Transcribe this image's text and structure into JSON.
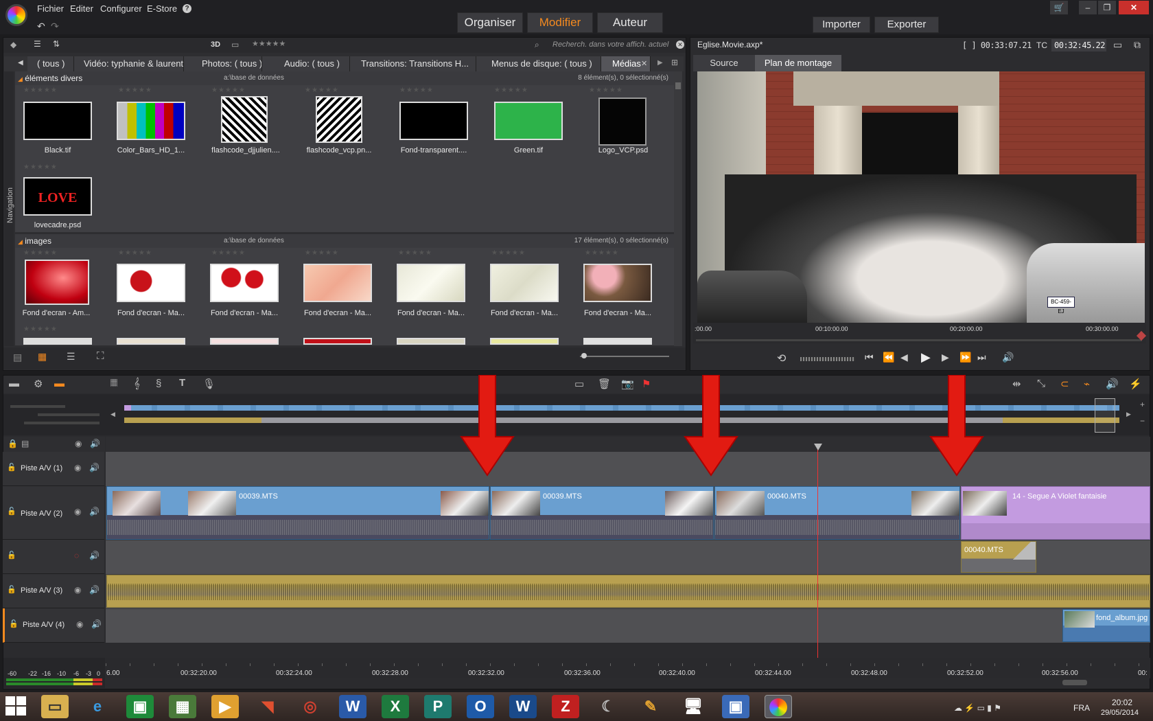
{
  "menu": {
    "fichier": "Fichier",
    "editer": "Editer",
    "configurer": "Configurer",
    "estore": "E-Store",
    "help": "?"
  },
  "modes": {
    "organiser": "Organiser",
    "modifier": "Modifier",
    "auteur": "Auteur"
  },
  "io": {
    "importer": "Importer",
    "exporter": "Exporter"
  },
  "library": {
    "toolbar": {
      "label_3d": "3D",
      "search_placeholder": "Recherch. dans votre affich. actuel"
    },
    "tabs": [
      "( tous )",
      "Vidéo: typhanie & laurent",
      "Photos: ( tous )",
      "Audio: ( tous )",
      "Transitions: Transitions H...",
      "Menus de disque: ( tous )",
      "Médias"
    ],
    "nav_label": "Navigation",
    "sections": [
      {
        "title": "éléments divers",
        "db": "a:\\base de données",
        "count": "8 élément(s), 0 sélectionné(s)",
        "items": [
          "Black.tif",
          "Color_Bars_HD_1...",
          "flashcode_djjulien....",
          "flashcode_vcp.pn...",
          "Fond-transparent....",
          "Green.tif",
          "Logo_VCP.psd",
          "lovecadre.psd"
        ]
      },
      {
        "title": "images",
        "db": "a:\\base de données",
        "count": "17 élément(s), 0 sélectionné(s)",
        "items": [
          "Fond d'ecran - Am...",
          "Fond d'ecran - Ma...",
          "Fond d'ecran - Ma...",
          "Fond d'ecran - Ma...",
          "Fond d'ecran - Ma...",
          "Fond d'ecran - Ma...",
          "Fond d'ecran - Ma..."
        ]
      }
    ],
    "lovecadre_text": "LOVE"
  },
  "preview": {
    "filename": "Eglise.Movie.axp*",
    "duration": "[ ] 00:33:07.21",
    "tc_label": "TC",
    "tc_value": "00:32:45.22",
    "tabs": [
      "Source",
      "Plan de montage"
    ],
    "ruler": [
      ":00.00",
      "00:10:00.00",
      "00:20:00.00",
      "00:30:00.00"
    ],
    "plate": "BC-459-EJ"
  },
  "timeline": {
    "tracks": [
      {
        "name": "Piste A/V (1)"
      },
      {
        "name": "Piste A/V (2)"
      },
      {
        "name": ""
      },
      {
        "name": "Piste A/V (3)"
      },
      {
        "name": "Piste A/V (4)"
      }
    ],
    "clips": {
      "c1": "00039.MTS",
      "c2": "00039.MTS",
      "c3": "00040.MTS",
      "c4": "14 - Segue A Violet fantaisie",
      "c5": "00040.MTS",
      "c6": "fond_album.jpg"
    },
    "ruler": [
      "6.00",
      "00:32:20.00",
      "00:32:24.00",
      "00:32:28.00",
      "00:32:32.00",
      "00:32:36.00",
      "00:32:40.00",
      "00:32:44.00",
      "00:32:48.00",
      "00:32:52.00",
      "00:32:56.00",
      "00:"
    ],
    "vu": [
      "-60",
      "-22",
      "-16",
      "-10",
      "-6",
      "-3",
      "0"
    ]
  },
  "taskbar": {
    "lang": "FRA",
    "time": "20:02",
    "date": "29/05/2014"
  },
  "colors": {
    "accent": "#f58a1f",
    "clip_blue": "#6a9fd0",
    "clip_purple": "#c39be0",
    "audio_gold": "#b8a050",
    "arrow_red": "#e21b12"
  }
}
